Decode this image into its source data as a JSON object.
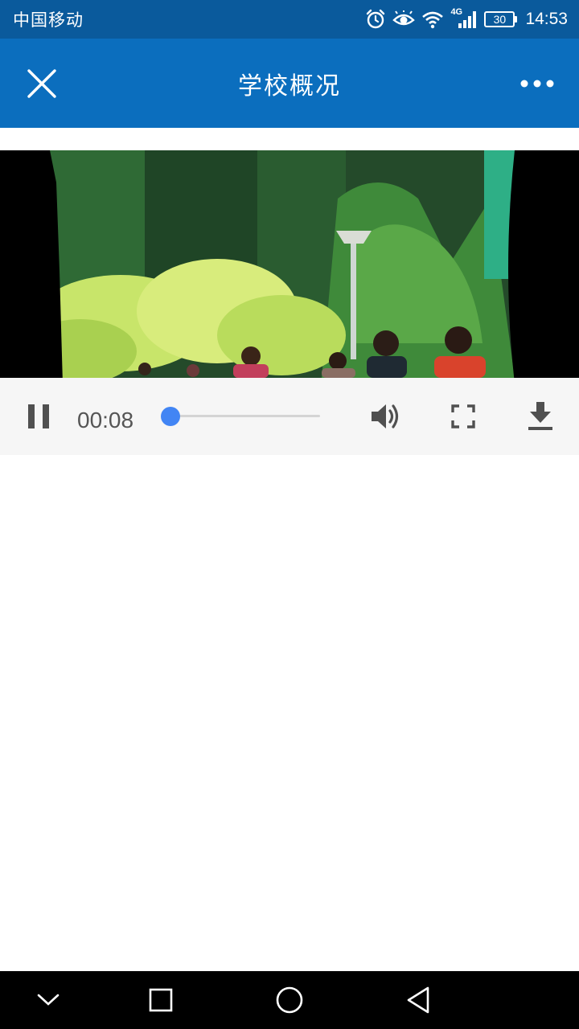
{
  "status_bar": {
    "carrier": "中国移动",
    "network": "4G",
    "battery_level": "30",
    "time": "14:53",
    "icons": [
      "alarm-icon",
      "eye-icon",
      "wifi-icon",
      "signal-icon",
      "battery-icon"
    ]
  },
  "app_bar": {
    "title": "学校概况",
    "close_icon": "close-icon",
    "more_icon": "more-dots-icon",
    "background_color": "#0b6ebe"
  },
  "video": {
    "current_time": "00:08",
    "progress": 0.02,
    "state": "playing",
    "controls": [
      "pause-icon",
      "volume-icon",
      "fullscreen-icon",
      "download-icon"
    ],
    "accent_color": "#4285f4"
  },
  "nav_bar": {
    "buttons": [
      "chevron-down-icon",
      "recents-square-icon",
      "home-circle-icon",
      "back-triangle-icon"
    ]
  }
}
